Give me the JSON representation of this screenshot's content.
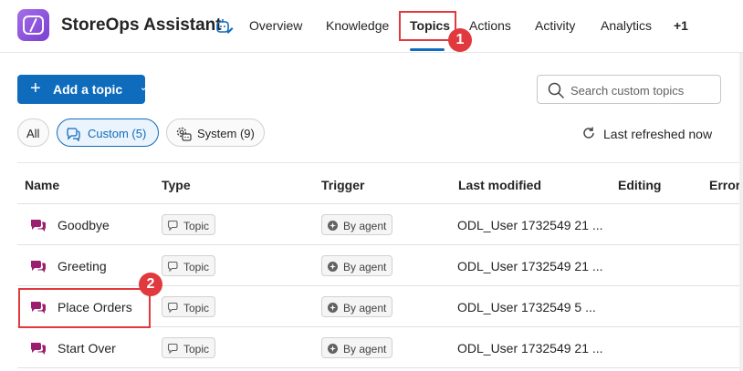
{
  "header": {
    "app_title": "StoreOps Assistant",
    "tabs": [
      {
        "label": "Overview"
      },
      {
        "label": "Knowledge"
      },
      {
        "label": "Topics"
      },
      {
        "label": "Actions"
      },
      {
        "label": "Activity"
      },
      {
        "label": "Analytics"
      },
      {
        "label": "+1"
      }
    ],
    "active_tab": "Topics"
  },
  "toolbar": {
    "add_topic_label": "Add a topic",
    "search_placeholder": "Search custom topics"
  },
  "filters": {
    "all": "All",
    "custom": "Custom (5)",
    "system": "System (9)",
    "selected": "Custom (5)"
  },
  "refresh": {
    "label": "Last refreshed now"
  },
  "table": {
    "columns": [
      "Name",
      "Type",
      "Trigger",
      "Last modified",
      "Editing",
      "Errors"
    ],
    "rows": [
      {
        "name": "Goodbye",
        "type": "Topic",
        "trigger": "By agent",
        "last_modified": "ODL_User 1732549   21 ..."
      },
      {
        "name": "Greeting",
        "type": "Topic",
        "trigger": "By agent",
        "last_modified": "ODL_User 1732549   21 ..."
      },
      {
        "name": "Place Orders",
        "type": "Topic",
        "trigger": "By agent",
        "last_modified": "ODL_User 1732549   5 ..."
      },
      {
        "name": "Start Over",
        "type": "Topic",
        "trigger": "By agent",
        "last_modified": "ODL_User 1732549   21 ..."
      }
    ]
  },
  "annotations": {
    "step1": "1",
    "step2": "2"
  },
  "colors": {
    "accent": "#0f6cbd",
    "callout": "#e0393e",
    "logo": "#8a4fe0",
    "topic_icon": "#9b1f6e"
  },
  "icons": {
    "app_logo": "copilot-studio-logo-icon",
    "agent_status": "agent-edit-icon",
    "search": "search-icon",
    "refresh": "refresh-icon",
    "topic": "chat-bubbles-icon",
    "system": "gear-cog-icon",
    "chip_topic": "chat-bubble-outline-icon",
    "chip_trigger": "sparkle-agent-icon"
  }
}
